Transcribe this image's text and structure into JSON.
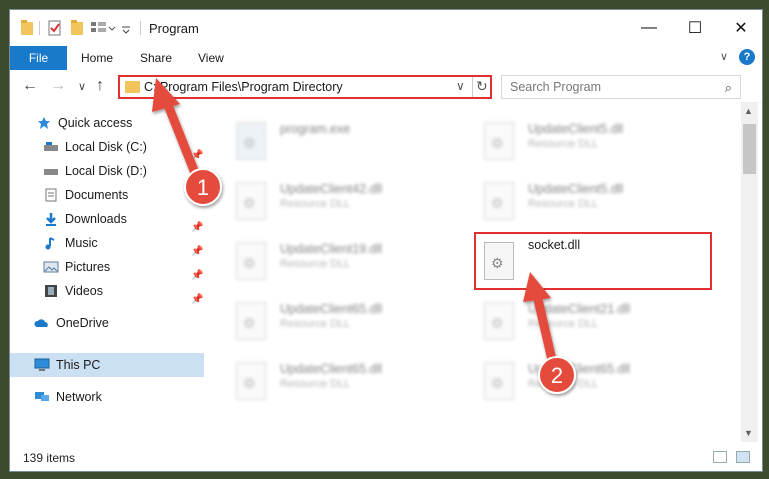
{
  "window": {
    "title": "Program",
    "minimize_label": "—",
    "maximize_label": "☐",
    "close_label": "✕"
  },
  "ribbon": {
    "file": "File",
    "home": "Home",
    "share": "Share",
    "view": "View",
    "expand_label": "∨",
    "help_label": "?"
  },
  "nav": {
    "back_label": "←",
    "forward_label": "→",
    "recent_label": "∨",
    "up_label": "↑",
    "address": "C:\\Program Files\\Program Directory",
    "address_dropdown": "∨",
    "refresh_label": "↻",
    "search_placeholder": "Search Program",
    "search_icon": "⌕"
  },
  "sidebar": {
    "items": [
      {
        "label": "Quick access"
      },
      {
        "label": "Local Disk (C:)"
      },
      {
        "label": "Local Disk (D:)"
      },
      {
        "label": "Documents"
      },
      {
        "label": "Downloads"
      },
      {
        "label": "Music"
      },
      {
        "label": "Pictures"
      },
      {
        "label": "Videos"
      },
      {
        "label": "OneDrive"
      },
      {
        "label": "This PC"
      },
      {
        "label": "Network"
      }
    ]
  },
  "files": [
    {
      "name": "program.exe",
      "type": ""
    },
    {
      "name": "UpdateClient5.dll",
      "type": "Resource DLL"
    },
    {
      "name": "UpdateClient42.dll",
      "type": "Resource DLL"
    },
    {
      "name": "UpdateClient5.dll",
      "type": "Resource DLL"
    },
    {
      "name": "UpdateClient19.dll",
      "type": "Resource DLL"
    },
    {
      "name": "socket.dll",
      "type": ""
    },
    {
      "name": "UpdateClient65.dll",
      "type": "Resource DLL"
    },
    {
      "name": "UpdateClient21.dll",
      "type": "Resource DLL"
    },
    {
      "name": "UpdateClient65.dll",
      "type": "Resource DLL"
    },
    {
      "name": "UpdateClient65.dll",
      "type": "Resource DLL"
    }
  ],
  "annotations": {
    "step1": "1",
    "step2": "2",
    "color": "#e03030"
  },
  "status": {
    "item_count": "139 items"
  },
  "colors": {
    "accent": "#1979ca",
    "highlight": "#e03030",
    "selected_nav": "#cce0f4"
  }
}
